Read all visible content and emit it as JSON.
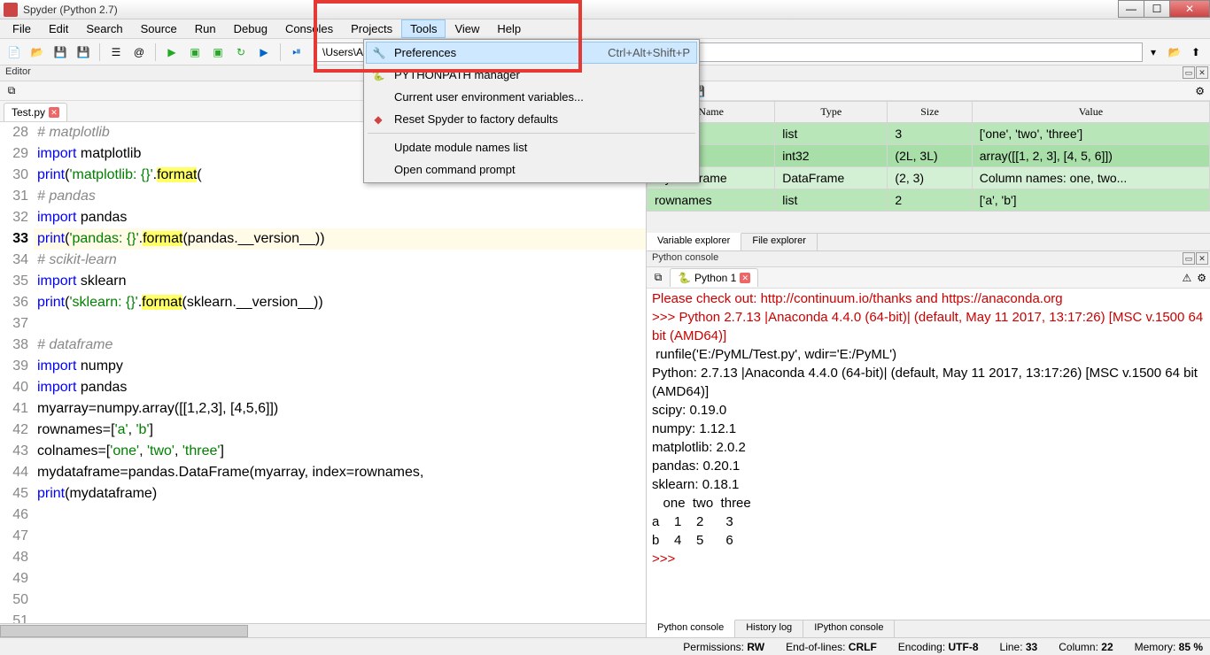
{
  "title": "Spyder (Python 2.7)",
  "menubar": [
    "File",
    "Edit",
    "Search",
    "Source",
    "Run",
    "Debug",
    "Consoles",
    "Projects",
    "Tools",
    "View",
    "Help"
  ],
  "tools_menu": {
    "preferences": "Preferences",
    "preferences_sc": "Ctrl+Alt+Shift+P",
    "pythonpath": "PYTHONPATH manager",
    "env": "Current user environment variables...",
    "reset": "Reset Spyder to factory defaults",
    "update": "Update module names list",
    "cmd": "Open command prompt"
  },
  "path": "\\Users\\Administrator",
  "editor": {
    "title": "Editor",
    "tab": "Test.py",
    "lines": [
      {
        "n": 28,
        "html": "<span class='cmt'># matplotlib</span>"
      },
      {
        "n": 29,
        "html": "<span class='kw'>import</span> matplotlib"
      },
      {
        "n": 30,
        "html": "<span class='kw'>print</span>(<span class='str'>'matplotlib: {}'</span>.<span class='hl'>format</span>("
      },
      {
        "n": 31,
        "html": "<span class='cmt'># pandas</span>"
      },
      {
        "n": 32,
        "html": "<span class='kw'>import</span> pandas"
      },
      {
        "n": 33,
        "html": "<span class='kw'>print</span>(<span class='str'>'pandas: {}'</span>.<span class='hl'>format</span>(pandas.__version__))",
        "current": true
      },
      {
        "n": 34,
        "html": "<span class='cmt'># scikit-learn</span>"
      },
      {
        "n": 35,
        "html": "<span class='kw'>import</span> sklearn"
      },
      {
        "n": 36,
        "html": "<span class='kw'>print</span>(<span class='str'>'sklearn: {}'</span>.<span class='hl'>format</span>(sklearn.__version__))"
      },
      {
        "n": 37,
        "html": ""
      },
      {
        "n": 38,
        "html": "<span class='cmt'># dataframe</span>"
      },
      {
        "n": 39,
        "html": "<span class='kw'>import</span> numpy"
      },
      {
        "n": 40,
        "html": "<span class='kw'>import</span> pandas"
      },
      {
        "n": 41,
        "html": "myarray=numpy.array([[1,2,3], [4,5,6]])"
      },
      {
        "n": 42,
        "html": "rownames=[<span class='str'>'a'</span>, <span class='str'>'b'</span>]"
      },
      {
        "n": 43,
        "html": "colnames=[<span class='str'>'one'</span>, <span class='str'>'two'</span>, <span class='str'>'three'</span>]"
      },
      {
        "n": 44,
        "html": "mydataframe=pandas.DataFrame(myarray, index=rownames,"
      },
      {
        "n": 45,
        "html": "<span class='kw'>print</span>(mydataframe)"
      },
      {
        "n": 46,
        "html": ""
      },
      {
        "n": 47,
        "html": ""
      },
      {
        "n": 48,
        "html": ""
      },
      {
        "n": 49,
        "html": ""
      },
      {
        "n": 50,
        "html": ""
      },
      {
        "n": 51,
        "html": ""
      },
      {
        "n": 52,
        "html": ""
      }
    ]
  },
  "varexp": {
    "title": "explorer",
    "headers": [
      "Name",
      "Type",
      "Size",
      "Value"
    ],
    "rows": [
      {
        "c": "row-green1",
        "name": "ames",
        "type": "list",
        "size": "3",
        "value": "['one', 'two', 'three']"
      },
      {
        "c": "row-greena",
        "name": "myarray",
        "type": "int32",
        "size": "(2L, 3L)",
        "value": "array([[1, 2, 3],\n       [4, 5, 6]])"
      },
      {
        "c": "row-green2",
        "name": "mydataframe",
        "type": "DataFrame",
        "size": "(2, 3)",
        "value": "Column names: one, two..."
      },
      {
        "c": "row-green1",
        "name": "rownames",
        "type": "list",
        "size": "2",
        "value": "['a', 'b']"
      }
    ],
    "tabs": [
      "Variable explorer",
      "File explorer"
    ]
  },
  "console": {
    "title": "Python console",
    "tab": "Python 1",
    "lines": [
      {
        "c": "c-red",
        "t": "Please check out: http://continuum.io/thanks and https://anaconda.org"
      },
      {
        "c": "c-red",
        "t": ">>> Python 2.7.13 |Anaconda 4.4.0 (64-bit)| (default, May 11 2017, 13:17:26) [MSC v.1500 64 bit (AMD64)]"
      },
      {
        "c": "c-blk",
        "t": " runfile('E:/PyML/Test.py', wdir='E:/PyML')"
      },
      {
        "c": "c-blk",
        "t": "Python: 2.7.13 |Anaconda 4.4.0 (64-bit)| (default, May 11 2017, 13:17:26) [MSC v.1500 64 bit (AMD64)]"
      },
      {
        "c": "c-blk",
        "t": "scipy: 0.19.0"
      },
      {
        "c": "c-blk",
        "t": "numpy: 1.12.1"
      },
      {
        "c": "c-blk",
        "t": "matplotlib: 2.0.2"
      },
      {
        "c": "c-blk",
        "t": "pandas: 0.20.1"
      },
      {
        "c": "c-blk",
        "t": "sklearn: 0.18.1"
      },
      {
        "c": "c-blk",
        "t": "   one  two  three"
      },
      {
        "c": "c-blk",
        "t": "a    1    2      3"
      },
      {
        "c": "c-blk",
        "t": "b    4    5      6"
      },
      {
        "c": "c-red",
        "t": ">>> "
      }
    ],
    "tabs": [
      "Python console",
      "History log",
      "IPython console"
    ]
  },
  "status": {
    "perm": "Permissions: ",
    "perm_v": "RW",
    "eol": "End-of-lines: ",
    "eol_v": "CRLF",
    "enc": "Encoding: ",
    "enc_v": "UTF-8",
    "line": "Line: ",
    "line_v": "33",
    "col": "Column: ",
    "col_v": "22",
    "mem": "Memory: ",
    "mem_v": "85 %"
  }
}
